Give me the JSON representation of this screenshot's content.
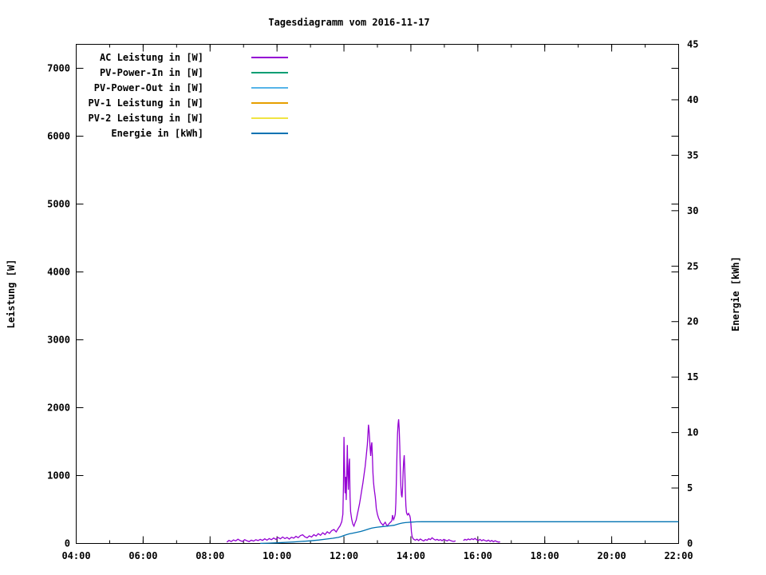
{
  "chart_data": {
    "type": "line",
    "title": "Tagesdiagramm vom 2016-11-17",
    "ylabel_left": "Leistung [W]",
    "ylabel_right": "Energie [kWh]",
    "background": "#ffffff",
    "border_color": "#000000",
    "grid": false,
    "legend_position": "top-left-inside",
    "x_axis": {
      "unit": "time_minutes_of_day",
      "min": 240,
      "max": 1320,
      "major_tick_values": [
        240,
        360,
        480,
        600,
        720,
        840,
        960,
        1080,
        1200,
        1320
      ],
      "major_tick_labels": [
        "04:00",
        "06:00",
        "08:00",
        "10:00",
        "12:00",
        "14:00",
        "16:00",
        "18:00",
        "20:00",
        "22:00"
      ],
      "minor_step": 60
    },
    "y_left_axis": {
      "unit": "W",
      "min": 0,
      "max": 7353,
      "major_tick_values": [
        0,
        1000,
        2000,
        3000,
        4000,
        5000,
        6000,
        7000
      ],
      "major_tick_labels": [
        "0",
        "1000",
        "2000",
        "3000",
        "4000",
        "5000",
        "6000",
        "7000"
      ]
    },
    "y_right_axis": {
      "unit": "kWh",
      "min": 0,
      "max": 45,
      "major_tick_values": [
        0,
        5,
        10,
        15,
        20,
        25,
        30,
        35,
        40,
        45
      ],
      "major_tick_labels": [
        "0",
        "5",
        "10",
        "15",
        "20",
        "25",
        "30",
        "35",
        "40",
        "45"
      ]
    },
    "series": [
      {
        "name": "AC Leistung in [W]",
        "color": "#9400d3",
        "axis": "left",
        "points": [
          [
            510,
            20
          ],
          [
            514,
            45
          ],
          [
            518,
            28
          ],
          [
            522,
            52
          ],
          [
            526,
            38
          ],
          [
            530,
            62
          ],
          [
            534,
            42
          ],
          [
            538,
            30
          ],
          [
            542,
            55
          ],
          [
            546,
            40
          ],
          [
            550,
            28
          ],
          [
            554,
            48
          ],
          [
            558,
            35
          ],
          [
            562,
            55
          ],
          [
            566,
            42
          ],
          [
            570,
            60
          ],
          [
            574,
            45
          ],
          [
            578,
            68
          ],
          [
            582,
            48
          ],
          [
            586,
            72
          ],
          [
            590,
            55
          ],
          [
            594,
            80
          ],
          [
            598,
            60
          ],
          [
            602,
            88
          ],
          [
            606,
            68
          ],
          [
            610,
            95
          ],
          [
            614,
            72
          ],
          [
            618,
            88
          ],
          [
            622,
            65
          ],
          [
            626,
            92
          ],
          [
            630,
            78
          ],
          [
            634,
            105
          ],
          [
            638,
            85
          ],
          [
            642,
            115
          ],
          [
            646,
            128
          ],
          [
            650,
            98
          ],
          [
            654,
            82
          ],
          [
            658,
            112
          ],
          [
            662,
            95
          ],
          [
            666,
            130
          ],
          [
            670,
            110
          ],
          [
            674,
            145
          ],
          [
            678,
            120
          ],
          [
            682,
            158
          ],
          [
            686,
            132
          ],
          [
            690,
            172
          ],
          [
            694,
            148
          ],
          [
            698,
            190
          ],
          [
            702,
            205
          ],
          [
            706,
            170
          ],
          [
            710,
            225
          ],
          [
            713,
            260
          ],
          [
            716,
            320
          ],
          [
            718,
            430
          ],
          [
            719,
            820
          ],
          [
            720,
            1570
          ],
          [
            721,
            1120
          ],
          [
            722,
            740
          ],
          [
            723,
            980
          ],
          [
            724,
            640
          ],
          [
            726,
            1450
          ],
          [
            727,
            1020
          ],
          [
            728,
            790
          ],
          [
            729,
            1140
          ],
          [
            730,
            1250
          ],
          [
            731,
            690
          ],
          [
            732,
            470
          ],
          [
            734,
            355
          ],
          [
            736,
            285
          ],
          [
            738,
            255
          ],
          [
            740,
            305
          ],
          [
            742,
            345
          ],
          [
            744,
            425
          ],
          [
            746,
            505
          ],
          [
            748,
            585
          ],
          [
            750,
            685
          ],
          [
            752,
            790
          ],
          [
            754,
            890
          ],
          [
            756,
            1010
          ],
          [
            758,
            1130
          ],
          [
            760,
            1290
          ],
          [
            762,
            1460
          ],
          [
            763,
            1610
          ],
          [
            764,
            1750
          ],
          [
            765,
            1670
          ],
          [
            766,
            1540
          ],
          [
            767,
            1400
          ],
          [
            768,
            1290
          ],
          [
            769,
            1430
          ],
          [
            770,
            1490
          ],
          [
            771,
            1290
          ],
          [
            772,
            1040
          ],
          [
            773,
            905
          ],
          [
            774,
            820
          ],
          [
            775,
            755
          ],
          [
            776,
            695
          ],
          [
            777,
            615
          ],
          [
            778,
            515
          ],
          [
            780,
            430
          ],
          [
            782,
            375
          ],
          [
            784,
            340
          ],
          [
            786,
            305
          ],
          [
            788,
            288
          ],
          [
            790,
            268
          ],
          [
            792,
            292
          ],
          [
            794,
            312
          ],
          [
            796,
            278
          ],
          [
            798,
            258
          ],
          [
            800,
            282
          ],
          [
            802,
            302
          ],
          [
            804,
            318
          ],
          [
            806,
            338
          ],
          [
            807,
            418
          ],
          [
            808,
            378
          ],
          [
            809,
            352
          ],
          [
            810,
            372
          ],
          [
            811,
            398
          ],
          [
            812,
            432
          ],
          [
            813,
            600
          ],
          [
            814,
            950
          ],
          [
            815,
            1310
          ],
          [
            816,
            1610
          ],
          [
            817,
            1760
          ],
          [
            818,
            1830
          ],
          [
            819,
            1690
          ],
          [
            820,
            1440
          ],
          [
            821,
            1090
          ],
          [
            822,
            845
          ],
          [
            823,
            715
          ],
          [
            824,
            680
          ],
          [
            825,
            805
          ],
          [
            826,
            1050
          ],
          [
            827,
            1210
          ],
          [
            828,
            1300
          ],
          [
            829,
            1080
          ],
          [
            830,
            770
          ],
          [
            831,
            555
          ],
          [
            832,
            458
          ],
          [
            833,
            432
          ],
          [
            834,
            420
          ],
          [
            835,
            432
          ],
          [
            836,
            442
          ],
          [
            837,
            424
          ],
          [
            838,
            412
          ],
          [
            839,
            375
          ],
          [
            840,
            295
          ],
          [
            841,
            175
          ],
          [
            842,
            115
          ],
          [
            843,
            85
          ],
          [
            845,
            62
          ],
          [
            848,
            48
          ],
          [
            851,
            62
          ],
          [
            854,
            42
          ],
          [
            857,
            66
          ],
          [
            860,
            50
          ],
          [
            863,
            36
          ],
          [
            866,
            58
          ],
          [
            869,
            46
          ],
          [
            872,
            70
          ],
          [
            875,
            56
          ],
          [
            878,
            84
          ],
          [
            881,
            64
          ],
          [
            884,
            50
          ],
          [
            887,
            60
          ],
          [
            890,
            46
          ],
          [
            893,
            56
          ],
          [
            896,
            40
          ],
          [
            899,
            60
          ],
          [
            902,
            50
          ],
          [
            905,
            36
          ],
          [
            908,
            54
          ],
          [
            911,
            44
          ],
          [
            914,
            34
          ],
          [
            917,
            30
          ],
          [
            920,
            38
          ],
          null,
          [
            934,
            44
          ],
          [
            937,
            60
          ],
          [
            940,
            50
          ],
          [
            943,
            66
          ],
          [
            946,
            54
          ],
          [
            949,
            70
          ],
          [
            952,
            58
          ],
          [
            955,
            74
          ],
          [
            958,
            54
          ],
          [
            961,
            44
          ],
          [
            964,
            60
          ],
          [
            967,
            40
          ],
          [
            970,
            54
          ],
          [
            973,
            44
          ],
          [
            976,
            34
          ],
          [
            979,
            50
          ],
          [
            982,
            30
          ],
          [
            985,
            44
          ],
          [
            988,
            26
          ],
          [
            991,
            40
          ],
          [
            994,
            28
          ],
          [
            997,
            20
          ],
          [
            1000,
            24
          ]
        ]
      },
      {
        "name": "PV-Power-In in [W]",
        "color": "#009e73",
        "axis": "left",
        "points": []
      },
      {
        "name": "PV-Power-Out in [W]",
        "color": "#56b4e9",
        "axis": "left",
        "points": []
      },
      {
        "name": "PV-1 Leistung in [W]",
        "color": "#e69f00",
        "axis": "left",
        "points": []
      },
      {
        "name": "PV-2 Leistung in [W]",
        "color": "#f0e442",
        "axis": "left",
        "points": []
      },
      {
        "name": "Energie in [kWh]",
        "color": "#0072b2",
        "axis": "right",
        "points": [
          [
            570,
            0.01
          ],
          [
            585,
            0.03
          ],
          [
            600,
            0.06
          ],
          [
            615,
            0.1
          ],
          [
            630,
            0.14
          ],
          [
            645,
            0.19
          ],
          [
            660,
            0.24
          ],
          [
            675,
            0.31
          ],
          [
            690,
            0.4
          ],
          [
            700,
            0.47
          ],
          [
            710,
            0.55
          ],
          [
            715,
            0.62
          ],
          [
            720,
            0.72
          ],
          [
            725,
            0.8
          ],
          [
            730,
            0.87
          ],
          [
            735,
            0.92
          ],
          [
            740,
            0.97
          ],
          [
            745,
            1.02
          ],
          [
            750,
            1.08
          ],
          [
            755,
            1.15
          ],
          [
            760,
            1.23
          ],
          [
            765,
            1.32
          ],
          [
            770,
            1.38
          ],
          [
            775,
            1.43
          ],
          [
            780,
            1.47
          ],
          [
            790,
            1.53
          ],
          [
            800,
            1.58
          ],
          [
            810,
            1.64
          ],
          [
            815,
            1.72
          ],
          [
            820,
            1.79
          ],
          [
            825,
            1.84
          ],
          [
            830,
            1.88
          ],
          [
            835,
            1.9
          ],
          [
            840,
            1.92
          ],
          [
            845,
            1.94
          ],
          [
            850,
            1.95
          ],
          [
            860,
            1.96
          ],
          [
            880,
            1.96
          ],
          [
            1320,
            1.96
          ]
        ]
      }
    ]
  }
}
